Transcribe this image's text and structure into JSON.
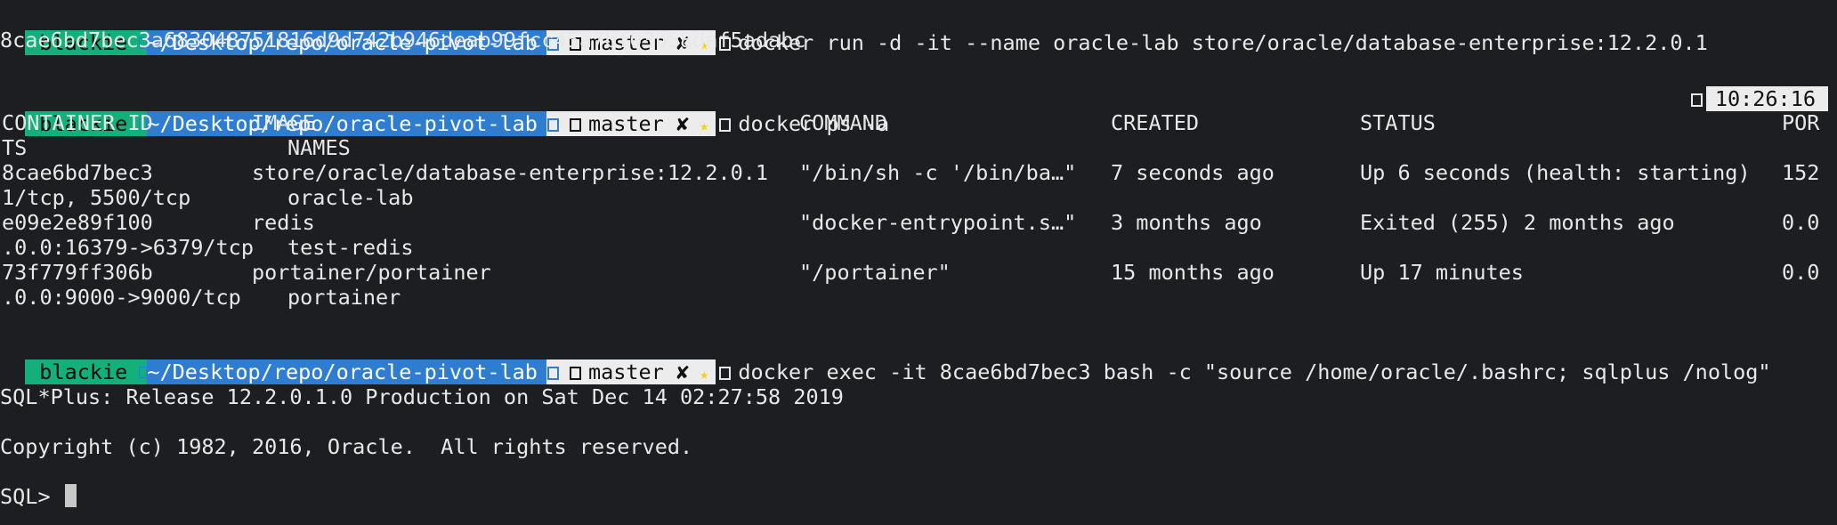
{
  "prompt": {
    "user": "blackie",
    "path": "~/Desktop/repo/oracle-pivot-lab",
    "branch": "master",
    "dirty_mark": "✘",
    "star": "★"
  },
  "commands": [
    "docker run -d -it --name oracle-lab store/oracle/database-enterprise:12.2.0.1",
    "docker ps -a",
    "docker exec -it 8cae6bd7bec3 bash -c \"source /home/oracle/.bashrc; sqlplus /nolog\""
  ],
  "run_output": "8cae6bd7bec3a683048751816d9d742b946deab99fcc45a7bf03b58daf5adabc",
  "right_prompt_time": "10:26:16",
  "ps_table": {
    "headers": {
      "container_id": "CONTAINER ID",
      "image": "IMAGE",
      "command": "COMMAND",
      "created": "CREATED",
      "status": "STATUS",
      "ports_start": "POR",
      "ports_wrap": "TS",
      "names": "NAMES"
    },
    "rows": [
      {
        "container_id": "8cae6bd7bec3",
        "image": "store/oracle/database-enterprise:12.2.0.1",
        "command": "\"/bin/sh -c '/bin/ba…\"",
        "created": "7 seconds ago",
        "status": "Up 6 seconds (health: starting)",
        "ports_start": "152",
        "ports_wrap": "1/tcp, 5500/tcp",
        "names": "oracle-lab"
      },
      {
        "container_id": "e09e2e89f100",
        "image": "redis",
        "command": "\"docker-entrypoint.s…\"",
        "created": "3 months ago",
        "status": "Exited (255) 2 months ago",
        "ports_start": "0.0",
        "ports_wrap": ".0.0:16379->6379/tcp",
        "names": "test-redis"
      },
      {
        "container_id": "73f779ff306b",
        "image": "portainer/portainer",
        "command": "\"/portainer\"",
        "created": "15 months ago",
        "status": "Up 17 minutes",
        "ports_start": "0.0",
        "ports_wrap": ".0.0:9000->9000/tcp",
        "names": "portainer"
      }
    ]
  },
  "sqlplus": {
    "banner": "SQL*Plus: Release 12.2.0.1.0 Production on Sat Dec 14 02:27:58 2019",
    "copyright": "Copyright (c) 1982, 2016, Oracle.  All rights reserved.",
    "prompt": "SQL> "
  },
  "colors": {
    "background": "#1c1e21",
    "user_segment": "#14b07c",
    "path_segment": "#2f7dd1",
    "git_segment": "#ececec",
    "star": "#f2d21b"
  }
}
